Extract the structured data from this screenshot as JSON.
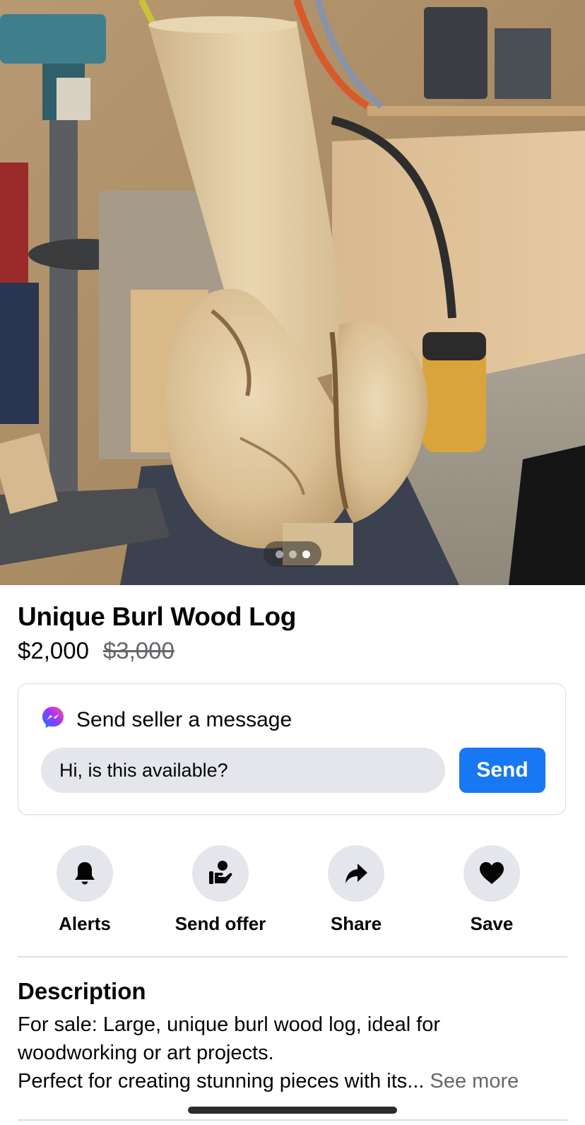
{
  "listing": {
    "title": "Unique Burl Wood Log",
    "price": "$2,000",
    "original_price": "$3,000",
    "photo": {
      "description_icon": "photo-burl-wood-log",
      "pages": 3,
      "active_page": 3
    }
  },
  "message_card": {
    "heading": "Send seller a message",
    "icon": "messenger-icon",
    "input_value": "Hi, is this available?",
    "send_label": "Send"
  },
  "actions": [
    {
      "label": "Alerts",
      "icon": "bell-icon"
    },
    {
      "label": "Send offer",
      "icon": "offer-hand-icon"
    },
    {
      "label": "Share",
      "icon": "share-arrow-icon"
    },
    {
      "label": "Save",
      "icon": "heart-icon"
    }
  ],
  "description": {
    "heading": "Description",
    "line1": "For sale: Large, unique burl wood log, ideal for",
    "line2": "woodworking or art projects.",
    "line3": "Perfect for creating stunning pieces with its...",
    "see_more": "See more"
  },
  "colors": {
    "accent": "#1877f2",
    "secondary_text": "#65676b",
    "button_bg": "#e4e6eb"
  }
}
